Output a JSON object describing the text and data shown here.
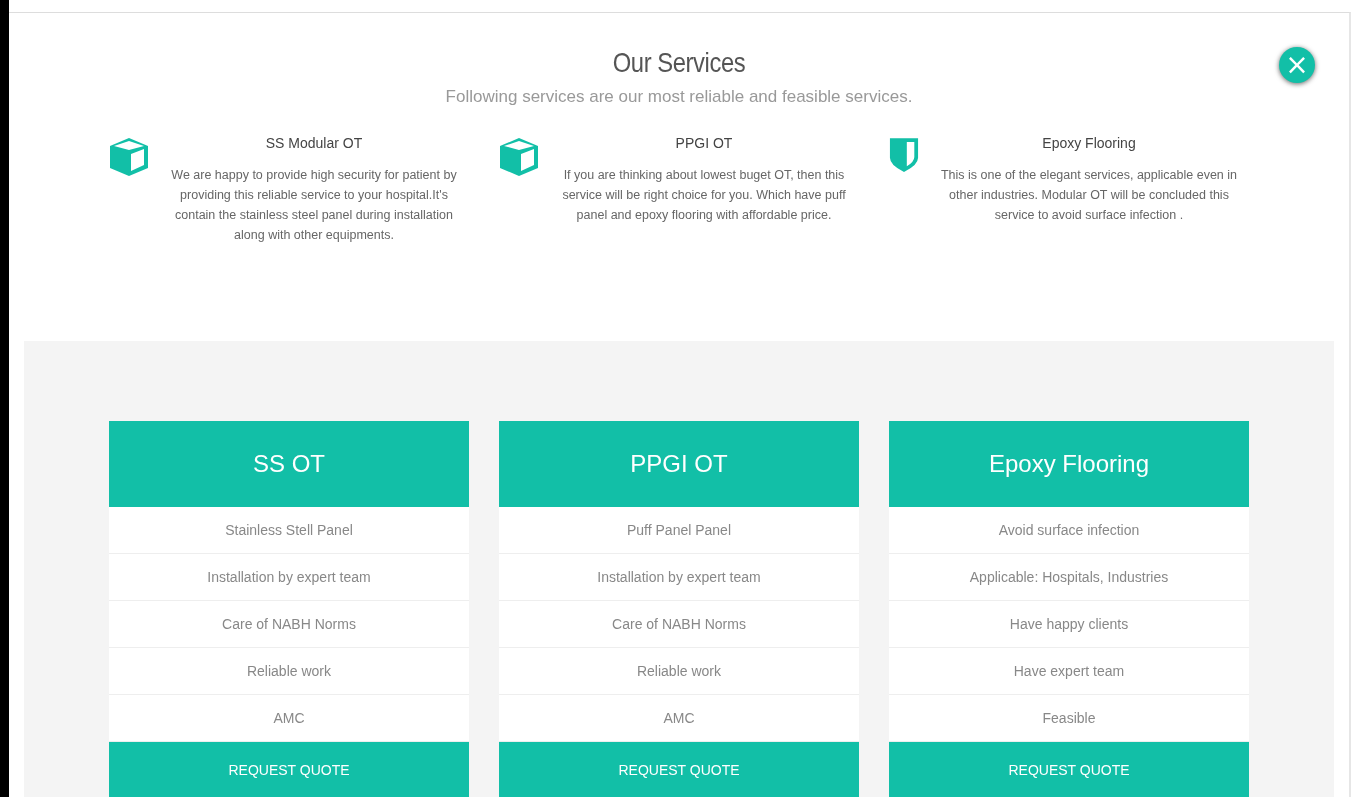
{
  "title": "Our Services",
  "subtitle": "Following services are our most reliable and feasible services.",
  "close_button": {
    "label": "×"
  },
  "services": [
    {
      "kind": "box",
      "title": "SS Modular OT",
      "text": "We are happy to provide high security for patient by providing this reliable service to your hospital.It's contain the stainless steel panel during installation along with other equipments."
    },
    {
      "kind": "box",
      "title": "PPGI OT",
      "text": "If you are thinking about lowest buget OT, then this service will be right choice for you. Which have puff panel and epoxy flooring with affordable price."
    },
    {
      "kind": "shield",
      "title": "Epoxy Flooring",
      "text": "This is one of the elegant services, applicable even in other industries. Modular OT will be concluded this service to avoid surface infection ."
    }
  ],
  "plans": [
    {
      "title": "SS OT",
      "features": [
        "Stainless Stell Panel",
        "Installation by expert team",
        "Care of NABH Norms",
        "Reliable work",
        "AMC"
      ],
      "button": "REQUEST QUOTE"
    },
    {
      "title": "PPGI OT",
      "features": [
        "Puff Panel Panel",
        "Installation by expert team",
        "Care of NABH Norms",
        "Reliable work",
        "AMC"
      ],
      "button": "REQUEST QUOTE"
    },
    {
      "title": "Epoxy Flooring",
      "features": [
        "Avoid surface infection",
        "Applicable: Hospitals, Industries",
        "Have happy clients",
        "Have expert team",
        "Feasible"
      ],
      "button": "REQUEST QUOTE"
    }
  ]
}
